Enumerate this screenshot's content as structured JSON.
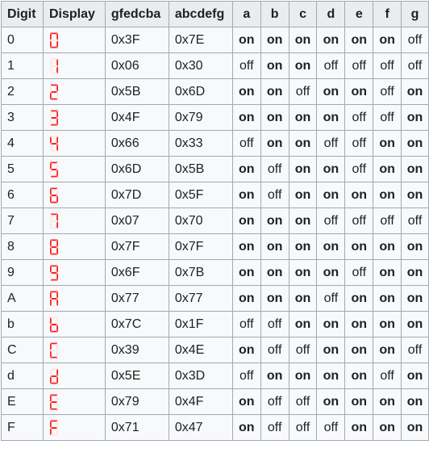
{
  "headers": [
    "Digit",
    "Display",
    "gfedcba",
    "abcdefg",
    "a",
    "b",
    "c",
    "d",
    "e",
    "f",
    "g"
  ],
  "on_label": "on",
  "off_label": "off",
  "colors": {
    "segment_on": "#ff2020",
    "segment_off": "#ffe6e6",
    "header_bg": "#eaecf0",
    "cell_bg": "#f8f9fa",
    "border": "#a2a9b1"
  },
  "rows": [
    {
      "digit": "0",
      "gfedcba": "0x3F",
      "abcdefg": "0x7E",
      "segments": [
        1,
        1,
        1,
        1,
        1,
        1,
        0
      ]
    },
    {
      "digit": "1",
      "gfedcba": "0x06",
      "abcdefg": "0x30",
      "segments": [
        0,
        1,
        1,
        0,
        0,
        0,
        0
      ]
    },
    {
      "digit": "2",
      "gfedcba": "0x5B",
      "abcdefg": "0x6D",
      "segments": [
        1,
        1,
        0,
        1,
        1,
        0,
        1
      ]
    },
    {
      "digit": "3",
      "gfedcba": "0x4F",
      "abcdefg": "0x79",
      "segments": [
        1,
        1,
        1,
        1,
        0,
        0,
        1
      ]
    },
    {
      "digit": "4",
      "gfedcba": "0x66",
      "abcdefg": "0x33",
      "segments": [
        0,
        1,
        1,
        0,
        0,
        1,
        1
      ]
    },
    {
      "digit": "5",
      "gfedcba": "0x6D",
      "abcdefg": "0x5B",
      "segments": [
        1,
        0,
        1,
        1,
        0,
        1,
        1
      ]
    },
    {
      "digit": "6",
      "gfedcba": "0x7D",
      "abcdefg": "0x5F",
      "segments": [
        1,
        0,
        1,
        1,
        1,
        1,
        1
      ]
    },
    {
      "digit": "7",
      "gfedcba": "0x07",
      "abcdefg": "0x70",
      "segments": [
        1,
        1,
        1,
        0,
        0,
        0,
        0
      ]
    },
    {
      "digit": "8",
      "gfedcba": "0x7F",
      "abcdefg": "0x7F",
      "segments": [
        1,
        1,
        1,
        1,
        1,
        1,
        1
      ]
    },
    {
      "digit": "9",
      "gfedcba": "0x6F",
      "abcdefg": "0x7B",
      "segments": [
        1,
        1,
        1,
        1,
        0,
        1,
        1
      ]
    },
    {
      "digit": "A",
      "gfedcba": "0x77",
      "abcdefg": "0x77",
      "segments": [
        1,
        1,
        1,
        0,
        1,
        1,
        1
      ]
    },
    {
      "digit": "b",
      "gfedcba": "0x7C",
      "abcdefg": "0x1F",
      "segments": [
        0,
        0,
        1,
        1,
        1,
        1,
        1
      ]
    },
    {
      "digit": "C",
      "gfedcba": "0x39",
      "abcdefg": "0x4E",
      "segments": [
        1,
        0,
        0,
        1,
        1,
        1,
        0
      ]
    },
    {
      "digit": "d",
      "gfedcba": "0x5E",
      "abcdefg": "0x3D",
      "segments": [
        0,
        1,
        1,
        1,
        1,
        0,
        1
      ]
    },
    {
      "digit": "E",
      "gfedcba": "0x79",
      "abcdefg": "0x4F",
      "segments": [
        1,
        0,
        0,
        1,
        1,
        1,
        1
      ]
    },
    {
      "digit": "F",
      "gfedcba": "0x71",
      "abcdefg": "0x47",
      "segments": [
        1,
        0,
        0,
        0,
        1,
        1,
        1
      ]
    }
  ]
}
